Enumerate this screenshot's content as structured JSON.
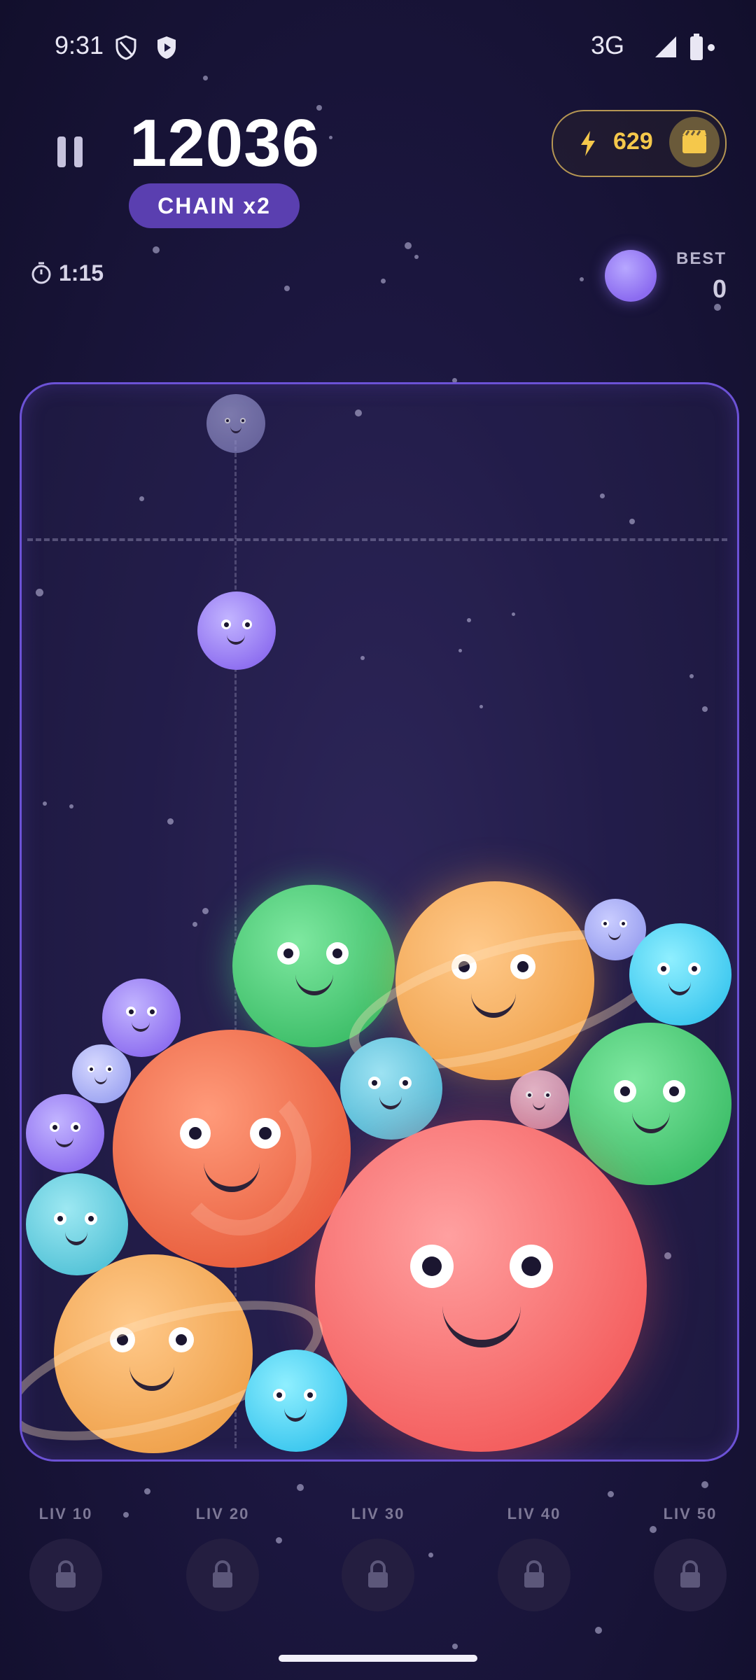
{
  "status_bar": {
    "time": "9:31",
    "network": "3G"
  },
  "header": {
    "score": "12036",
    "chain": "CHAIN  x2",
    "energy": "629",
    "timer": "1:15",
    "best_label": "BEST",
    "best_value": "0"
  },
  "icons": [
    "pause-icon",
    "bolt-icon",
    "video-icon",
    "timer-icon",
    "lock-icon",
    "shield-icon",
    "signal-icon",
    "battery-icon"
  ],
  "colors": {
    "accent": "#5a3fb0",
    "energy": "#f5c84b",
    "board_border": "#6c52d6"
  },
  "levels": [
    {
      "label": "LIV 10"
    },
    {
      "label": "LIV 20"
    },
    {
      "label": "LIV 30"
    },
    {
      "label": "LIV 40"
    },
    {
      "label": "LIV 50"
    }
  ]
}
